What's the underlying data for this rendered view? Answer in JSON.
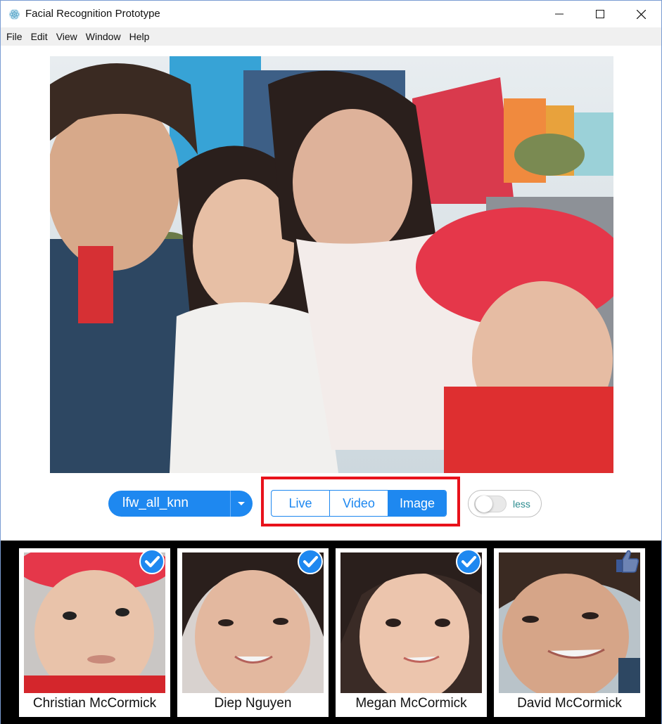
{
  "window": {
    "title": "Facial Recognition Prototype",
    "icon": "react-atom-icon"
  },
  "menu": [
    "File",
    "Edit",
    "View",
    "Window",
    "Help"
  ],
  "photo": {
    "description_icon": "family-photo"
  },
  "controls": {
    "model_select": {
      "value": "lfw_all_knn"
    },
    "source_modes": [
      {
        "label": "Live",
        "selected": false
      },
      {
        "label": "Video",
        "selected": false
      },
      {
        "label": "Image",
        "selected": true
      }
    ],
    "detail_toggle": {
      "label": "less",
      "on": false
    }
  },
  "results": [
    {
      "name": "Christian McCormick",
      "badge": "check-badge-icon"
    },
    {
      "name": "Diep Nguyen",
      "badge": "check-badge-icon"
    },
    {
      "name": "Megan McCormick",
      "badge": "check-badge-icon"
    },
    {
      "name": "David McCormick",
      "badge": "thumbs-up-icon"
    }
  ],
  "colors": {
    "accent": "#1e88f0",
    "highlight": "#e8121b",
    "strip_bg": "#000000"
  }
}
